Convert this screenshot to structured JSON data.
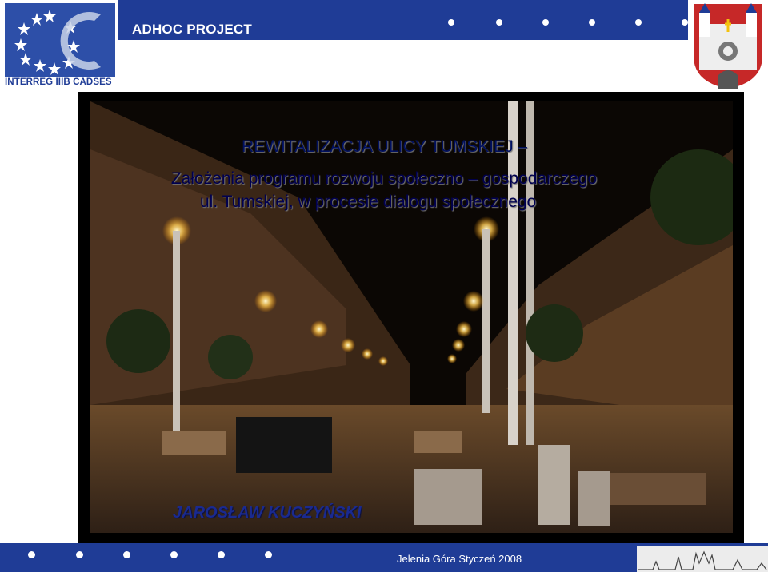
{
  "header": {
    "project_title": "ADHOC PROJECT"
  },
  "logo": {
    "text": "INTERREG IIIB CADSES",
    "icon": "eu-stars-logo"
  },
  "crest": {
    "icon": "city-coat-of-arms"
  },
  "slide": {
    "title_line1": "REWITALIZACJA ULICY TUMSKIEJ –",
    "title_line2": "Założenia programu rozwoju społeczno – gospodarczego",
    "title_line3": "ul. Tumskiej, w procesie dialogu społecznego",
    "author": "JAROSŁAW KUCZYŃSKI"
  },
  "footer": {
    "text": "Jelenia Góra Styczeń 2008",
    "icon": "city-skyline-drawing"
  },
  "colors": {
    "brand_blue": "#1f3c96",
    "title_text": "#000050"
  }
}
